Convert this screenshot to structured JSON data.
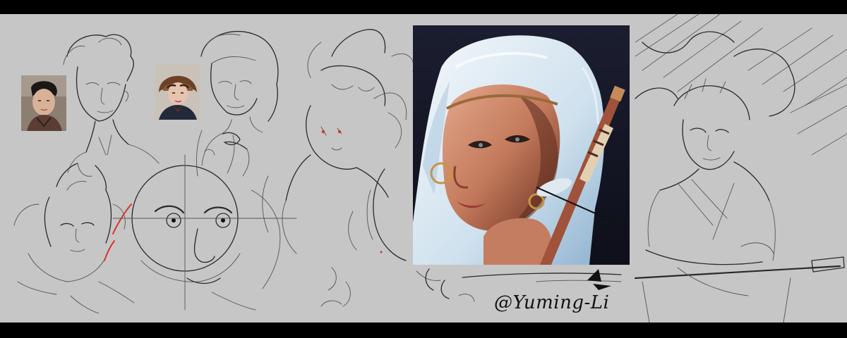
{
  "artwork": {
    "signature": "@Yuming-Li"
  },
  "colors": {
    "letterbox": "#000000",
    "canvas": "#c6c6c6",
    "ink": "#2a2a2a",
    "accent_red": "#d8342f",
    "painting_bg": "#141626",
    "hood_white": "#e6eef4"
  }
}
